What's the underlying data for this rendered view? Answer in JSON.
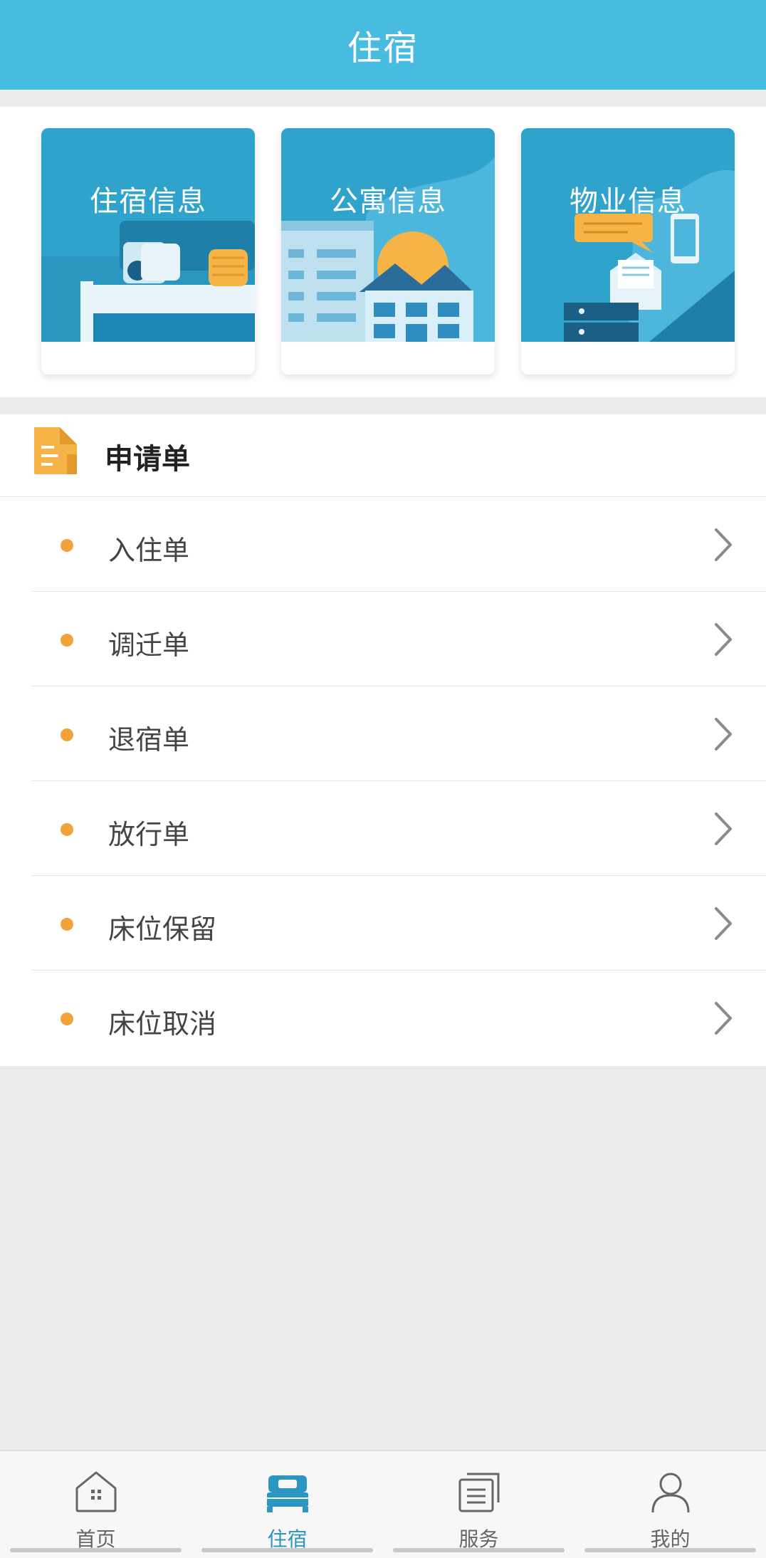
{
  "header": {
    "title": "住宿"
  },
  "cards": [
    {
      "label": "住宿信息",
      "icon": "bed-illustration"
    },
    {
      "label": "公寓信息",
      "icon": "apartment-illustration"
    },
    {
      "label": "物业信息",
      "icon": "property-illustration"
    }
  ],
  "section": {
    "title": "申请单",
    "icon": "document-icon",
    "items": [
      {
        "label": "入住单"
      },
      {
        "label": "调迁单"
      },
      {
        "label": "退宿单"
      },
      {
        "label": "放行单"
      },
      {
        "label": "床位保留"
      },
      {
        "label": "床位取消"
      }
    ]
  },
  "tabbar": {
    "active": 1,
    "tabs": [
      {
        "label": "首页",
        "icon": "home-icon"
      },
      {
        "label": "住宿",
        "icon": "bed-icon"
      },
      {
        "label": "服务",
        "icon": "service-list-icon"
      },
      {
        "label": "我的",
        "icon": "user-icon"
      }
    ]
  },
  "colors": {
    "header": "#48bbe0",
    "accent_dot": "#f0a23b",
    "active_tab": "#2b96c2"
  }
}
